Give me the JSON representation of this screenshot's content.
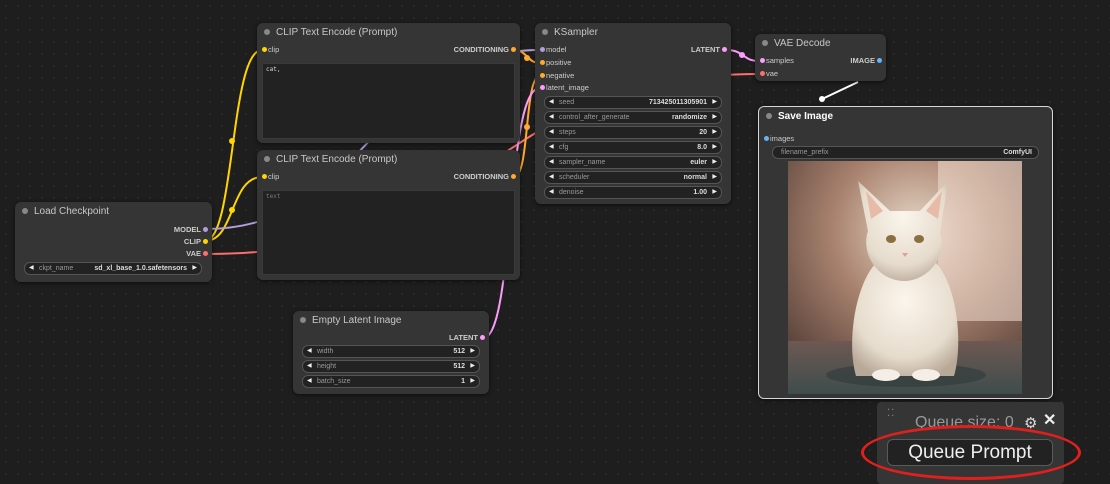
{
  "colors": {
    "model": "#b39ddb",
    "clip": "#ffd500",
    "conditioning": "#ffa931",
    "latent": "#ff9cf9",
    "vae": "#ff6e6e",
    "image": "#64b5f6",
    "highlight": "#e0201c"
  },
  "load_checkpoint": {
    "title": "Load Checkpoint",
    "outputs": [
      "MODEL",
      "CLIP",
      "VAE"
    ],
    "widget": {
      "name": "ckpt_name",
      "value": "sd_xl_base_1.0.safetensors"
    }
  },
  "clip_pos": {
    "title": "CLIP Text Encode (Prompt)",
    "input": "clip",
    "output": "CONDITIONING",
    "text": "cat,"
  },
  "clip_neg": {
    "title": "CLIP Text Encode (Prompt)",
    "input": "clip",
    "output": "CONDITIONING",
    "placeholder": "text"
  },
  "ksampler": {
    "title": "KSampler",
    "inputs": [
      "model",
      "positive",
      "negative",
      "latent_image"
    ],
    "output": "LATENT",
    "widgets": [
      {
        "name": "seed",
        "value": "713425011305901"
      },
      {
        "name": "control_after_generate",
        "value": "randomize"
      },
      {
        "name": "steps",
        "value": "20"
      },
      {
        "name": "cfg",
        "value": "8.0"
      },
      {
        "name": "sampler_name",
        "value": "euler"
      },
      {
        "name": "scheduler",
        "value": "normal"
      },
      {
        "name": "denoise",
        "value": "1.00"
      }
    ]
  },
  "vae_decode": {
    "title": "VAE Decode",
    "inputs": [
      "samples",
      "vae"
    ],
    "output": "IMAGE"
  },
  "save_image": {
    "title": "Save Image",
    "input": "images",
    "widget": {
      "name": "filename_prefix",
      "value": "ComfyUI"
    }
  },
  "empty_latent": {
    "title": "Empty Latent Image",
    "output": "LATENT",
    "widgets": [
      {
        "name": "width",
        "value": "512"
      },
      {
        "name": "height",
        "value": "512"
      },
      {
        "name": "batch_size",
        "value": "1"
      }
    ]
  },
  "queue": {
    "size_label": "Queue size: 0",
    "button": "Queue Prompt",
    "drag_icon": "drag-handle-icon",
    "settings_icon": "gear-icon",
    "close_icon": "close-icon"
  }
}
